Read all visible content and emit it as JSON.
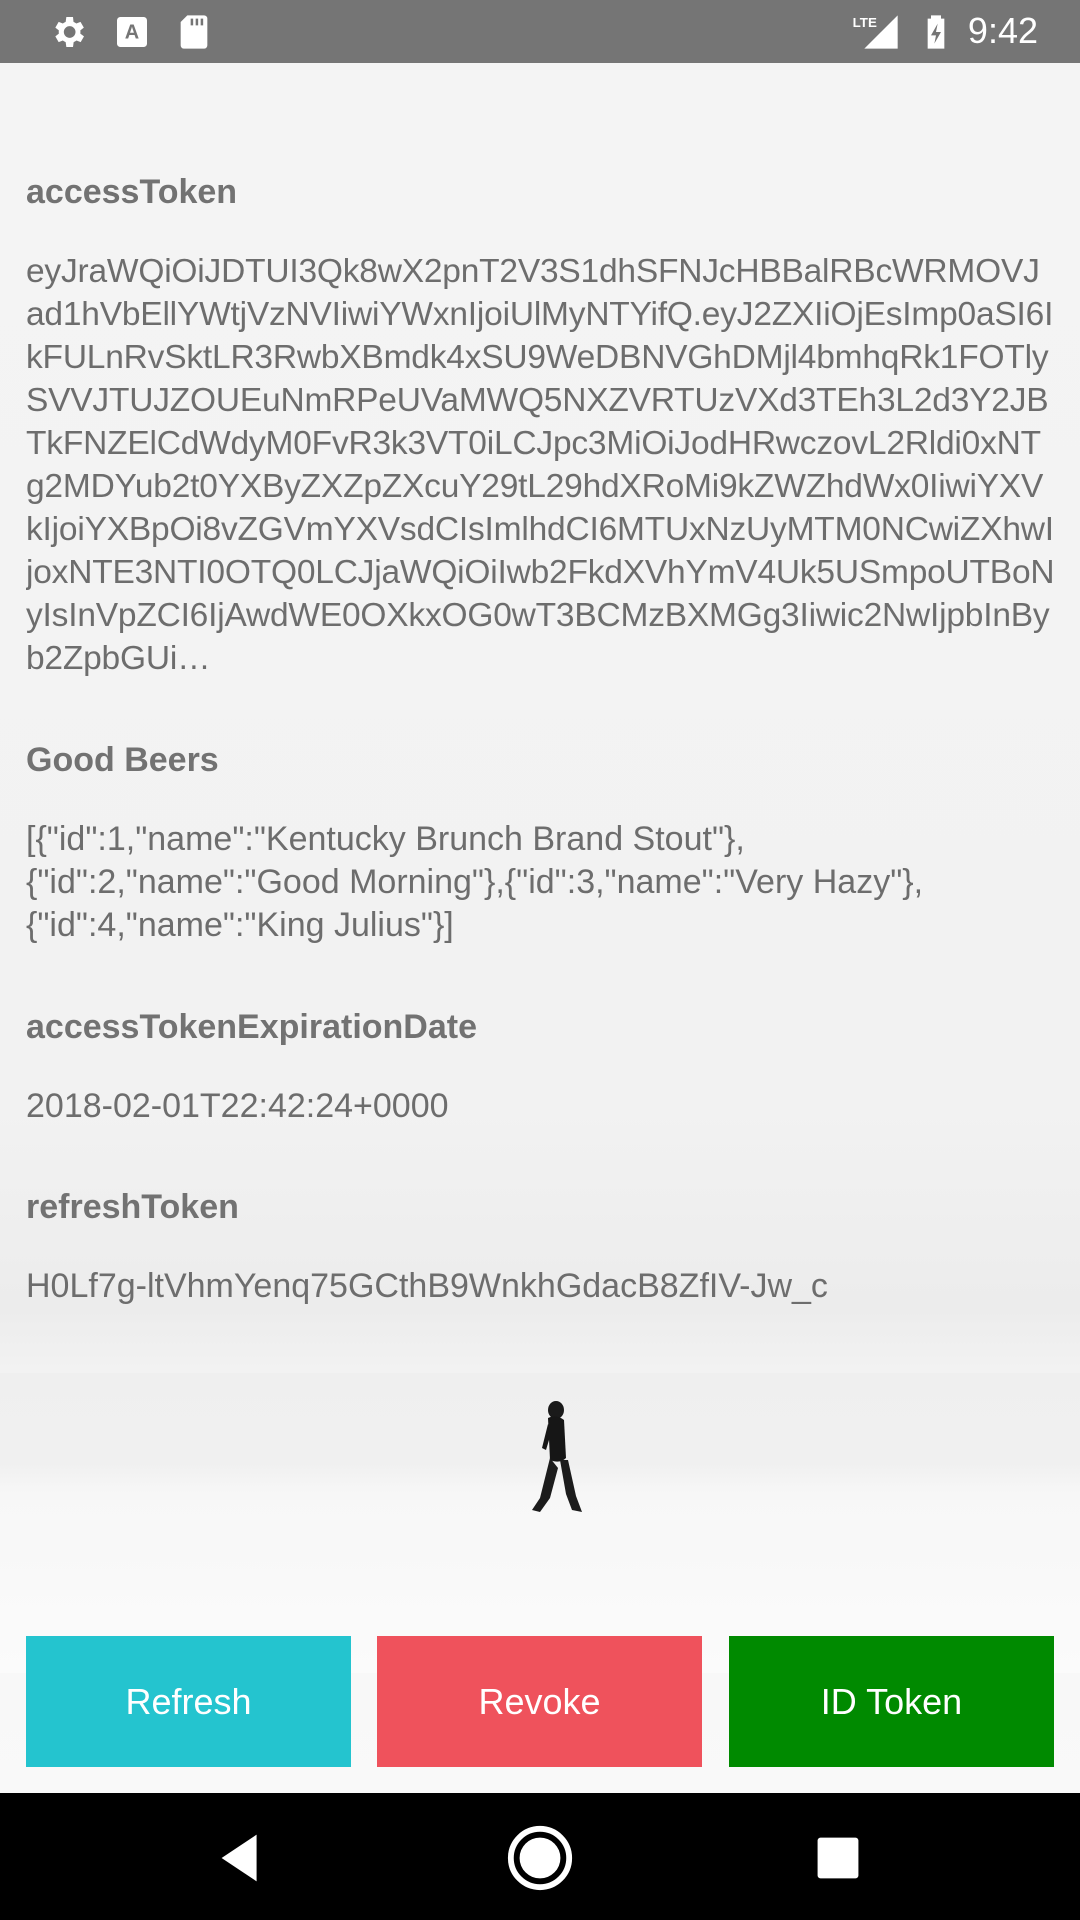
{
  "status_bar": {
    "time": "9:42",
    "network": "LTE",
    "icons": [
      "settings-icon",
      "keyboard-a-icon",
      "sd-card-icon",
      "signal-icon",
      "battery-charging-icon"
    ]
  },
  "fields": {
    "access_token": {
      "label": "accessToken",
      "value": "eyJraWQiOiJDTUI3Qk8wX2pnT2V3S1dhSFNJcHBBalRBcWRMOVJad1hVbEllYWtjVzNVIiwiYWxnIjoiUlMyNTYifQ.eyJ2ZXIiOjEsImp0aSI6IkFULnRvSktLR3RwbXBmdk4xSU9WeDBNVGhDMjl4bmhqRk1FOTlySVVJTUJZOUEuNmRPeUVaMWQ5NXZVRTUzVXd3TEh3L2d3Y2JBTkFNZElCdWdyM0FvR3k3VT0iLCJpc3MiOiJodHRwczovL2Rldi0xNTg2MDYub2t0YXByZXZpZXcuY29tL29hdXRoMi9kZWZhdWx0IiwiYXVkIjoiYXBpOi8vZGVmYXVsdCIsImlhdCI6MTUxNzUyMTM0NCwiZXhwIjoxNTE3NTI0OTQ0LCJjaWQiOiIwb2FkdXVhYmV4Uk5USmpoUTBoNyIsInVpZCI6IjAwdWE0OXkxOG0wT3BCMzBXMGg3Iiwic2NwIjpbInByb2ZpbGUi…"
    },
    "good_beers": {
      "label": "Good Beers",
      "value": "[{\"id\":1,\"name\":\"Kentucky Brunch Brand Stout\"},{\"id\":2,\"name\":\"Good Morning\"},{\"id\":3,\"name\":\"Very Hazy\"},{\"id\":4,\"name\":\"King Julius\"}]"
    },
    "expiration": {
      "label": "accessTokenExpirationDate",
      "value": "2018-02-01T22:42:24+0000"
    },
    "refresh_token": {
      "label": "refreshToken",
      "value": "H0Lf7g-ltVhmYenq75GCthB9WnkhGdacB8ZfIV-Jw_c"
    }
  },
  "buttons": {
    "refresh": {
      "label": "Refresh",
      "color": "#24c4cf"
    },
    "revoke": {
      "label": "Revoke",
      "color": "#ef525c"
    },
    "id_token": {
      "label": "ID Token",
      "color": "#008a00"
    }
  },
  "nav_bar": {
    "icons": [
      "back-icon",
      "home-icon",
      "recents-icon"
    ]
  }
}
